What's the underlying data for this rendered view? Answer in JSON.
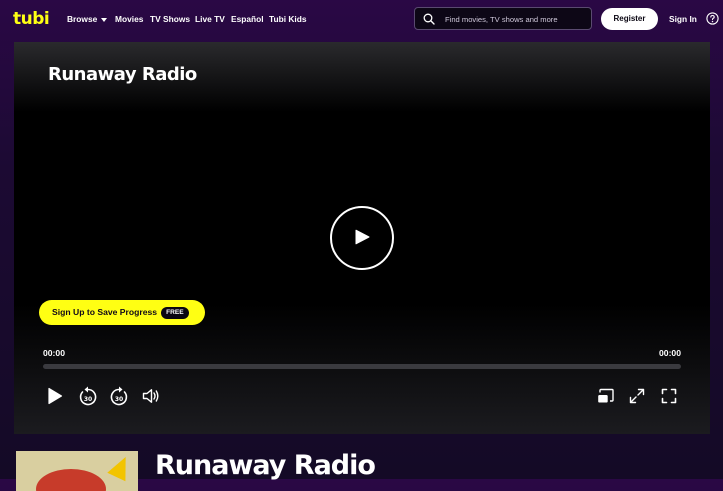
{
  "header": {
    "logo": "tubi",
    "nav": [
      "Browse",
      "Movies",
      "TV Shows",
      "Live TV",
      "Español",
      "Tubi Kids"
    ],
    "search_placeholder": "Find movies, TV shows and more",
    "register_label": "Register",
    "signin_label": "Sign In"
  },
  "player": {
    "title": "Runaway Radio",
    "signup_label": "Sign Up to Save Progress",
    "free_badge": "FREE",
    "time_elapsed": "00:00",
    "time_total": "00:00",
    "progress": 0,
    "rewind_seconds": "30",
    "forward_seconds": "30"
  },
  "details": {
    "title": "Runaway Radio"
  },
  "colors": {
    "accent": "#ffff13",
    "background": "#1c0a33",
    "player_bg": "#000000"
  }
}
